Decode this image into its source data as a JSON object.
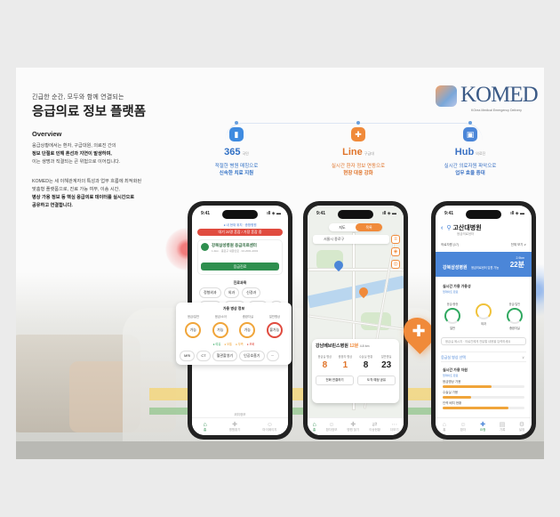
{
  "poster": {
    "kicker": "긴급한 순간, 모두와 함께 연결되는",
    "headline": "응급의료 정보 플랫폼",
    "overview_title": "Overview",
    "overview_p1_a": "응급상황에서는 환자, 구급대원, 의료진 간의",
    "overview_p1_b": "정보 단절로 인해 혼선과 지연이 발생하며,",
    "overview_p1_c": "이는 생명과 직결되는 큰 위험으로 이어집니다.",
    "overview_p2_a": "KOMED는 세 이해관계자의 특성과 업무 흐름에 최적화된",
    "overview_p2_b": "맞춤형 플랫폼으로, 진료 가능 여부, 이송 시간,",
    "overview_p2_c": "병상 가용 정보 등 핵심 응급의료 데이터를 실시간으로",
    "overview_p2_d": "공유하고 연결합니다."
  },
  "logo": {
    "text": "KOMED",
    "sub": "KOrea Medical Emergency Delivery"
  },
  "features": [
    {
      "title": "365",
      "tag": "국민",
      "desc1": "적절한 병원 매칭으로",
      "desc2": "신속한 치료 지원"
    },
    {
      "title": "Line",
      "tag": "구급대",
      "desc1": "실시간 환자 정보 연동으로",
      "desc2": "현장 대응 강화"
    },
    {
      "title": "Hub",
      "tag": "의료진",
      "desc1": "실시간 의료자원 파악으로",
      "desc2": "업무 효율 증대"
    }
  ],
  "phone1": {
    "time": "9:41",
    "signal": "ıll ◈ ▬",
    "search": "● 내 현재 위치 · 종합병원",
    "banner": "대기 20명 혼잡 / 가장 혼잡 중",
    "hospital": "강북삼성병원 응급의료센터",
    "hospital_sub": "1.2km · 종로구 새문안로 · 02-2001-2001",
    "call_btn": "응급진료",
    "dept_title": "진료과목",
    "depts": [
      "정형외과",
      "외과",
      "신경과",
      "흉부외과",
      "산부인과",
      "소아과",
      "···"
    ],
    "status_title": "가용 병상 정보",
    "status_cols": [
      "응급/일반",
      "응급/소아",
      "중환자실",
      "일반병상"
    ],
    "status_vals": [
      "가능",
      "가능",
      "가능",
      "불가능"
    ],
    "legend": [
      "● 여유",
      "● 보통",
      "● 부족",
      "● 포화"
    ],
    "equip": [
      "MRI",
      "CT",
      "혈관촬영기",
      "인공호흡기",
      "···"
    ],
    "footer": "위치정보",
    "tabs": [
      "홈",
      "병원찾기",
      "마이페이지"
    ]
  },
  "phone2": {
    "time": "9:41",
    "signal": "ıll ◈ ▬",
    "toggle": [
      "지도",
      "목록"
    ],
    "search": "서울시 종로구",
    "card_name": "강남베브린스병원",
    "card_eta": "12분",
    "card_dist": "4.8 km",
    "cols": [
      "응급실 병상",
      "중환자 병상",
      "수술실 현황",
      "일반병실"
    ],
    "vals": [
      "8",
      "1",
      "8",
      "23"
    ],
    "btns": [
      "전화 연결하기",
      "도착 예정 공유"
    ],
    "tabs": [
      "홈",
      "환자정보",
      "병원 찾기",
      "이송현황",
      "더보기"
    ]
  },
  "phone3": {
    "time": "9:41",
    "signal": "ıll ◈ ▬",
    "title": "고산대병원",
    "subtitle": "응급의료센터",
    "row_left": "의료자원 (17)",
    "row_right": "전체 보기 ∨",
    "blue_name": "강북삼성병원",
    "blue_tag": "응급의료센터 입원 가능",
    "blue_dist": "22분",
    "blue_dist_sub": "2.9km",
    "sec1": "실시간 가용 가용성",
    "sec1_sub": "업데이트 완료",
    "gauges": [
      {
        "h": "응급/중증",
        "l": "일반"
      },
      {
        "h": "",
        "l": "외과"
      },
      {
        "h": "응급/일반",
        "l": "중환자실"
      }
    ],
    "input": "응급실 메시지 · 의료진에게 전달할 내용을 입력하세요",
    "select": "응급실 병상 선택",
    "sec2": "실시간 가용 자원",
    "sec2_sub": "업데이트 완료",
    "list": [
      "응급병상 가용",
      "수술실 가용",
      "인력 배치 현황"
    ],
    "list_pct": [
      0.6,
      0.35,
      0.8
    ],
    "tabs": [
      "홈",
      "환자",
      "요청",
      "기록",
      "설정"
    ]
  }
}
